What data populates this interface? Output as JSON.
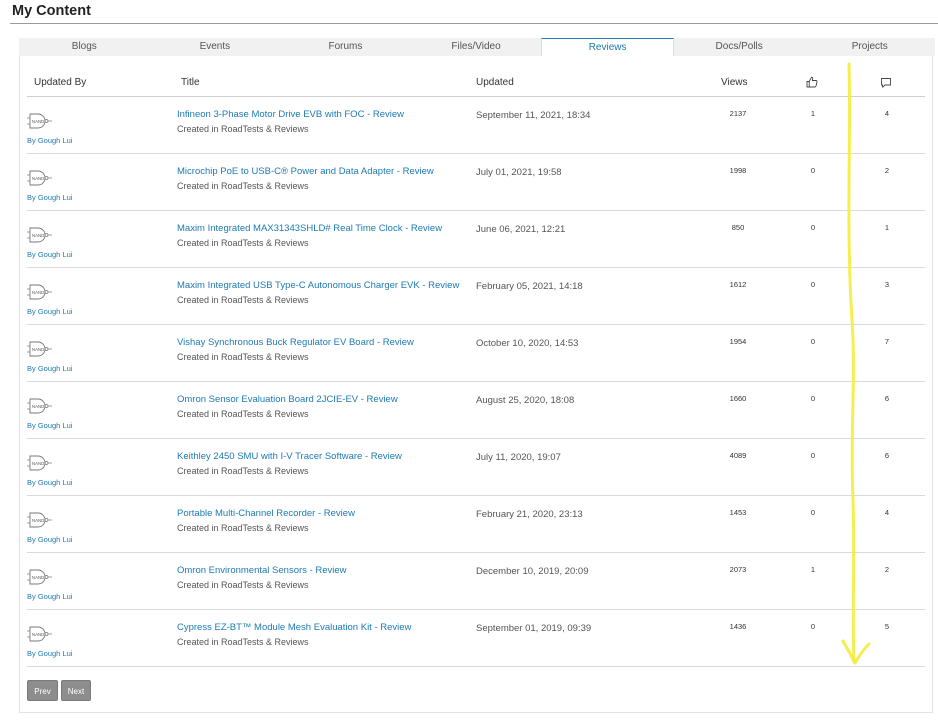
{
  "page_title": "My Content",
  "tabs": [
    {
      "label": "Blogs",
      "active": false
    },
    {
      "label": "Events",
      "active": false
    },
    {
      "label": "Forums",
      "active": false
    },
    {
      "label": "Files/Video",
      "active": false
    },
    {
      "label": "Reviews",
      "active": true
    },
    {
      "label": "Docs/Polls",
      "active": false
    },
    {
      "label": "Projects",
      "active": false
    }
  ],
  "columns": {
    "updated_by": "Updated By",
    "title": "Title",
    "updated": "Updated",
    "views": "Views",
    "likes_icon": "thumbs-up-icon",
    "comments_icon": "comment-icon"
  },
  "rows": [
    {
      "author": "By Gough Lui",
      "title": "Infineon 3-Phase Motor Drive EVB with FOC - Review",
      "created": "Created in RoadTests & Reviews",
      "updated": "September 11, 2021, 18:34",
      "views": "2137",
      "likes": "1",
      "comments": "4"
    },
    {
      "author": "By Gough Lui",
      "title": "Microchip PoE to USB-C® Power and Data Adapter - Review",
      "created": "Created in RoadTests & Reviews",
      "updated": "July 01, 2021, 19:58",
      "views": "1998",
      "likes": "0",
      "comments": "2"
    },
    {
      "author": "By Gough Lui",
      "title": "Maxim Integrated MAX31343SHLD# Real Time Clock - Review",
      "created": "Created in RoadTests & Reviews",
      "updated": "June 06, 2021, 12:21",
      "views": "850",
      "likes": "0",
      "comments": "1"
    },
    {
      "author": "By Gough Lui",
      "title": "Maxim Integrated USB Type-C Autonomous Charger EVK - Review",
      "created": "Created in RoadTests & Reviews",
      "updated": "February 05, 2021, 14:18",
      "views": "1612",
      "likes": "0",
      "comments": "3"
    },
    {
      "author": "By Gough Lui",
      "title": "Vishay Synchronous Buck Regulator EV Board - Review",
      "created": "Created in RoadTests & Reviews",
      "updated": "October 10, 2020, 14:53",
      "views": "1954",
      "likes": "0",
      "comments": "7"
    },
    {
      "author": "By Gough Lui",
      "title": "Omron Sensor Evaluation Board 2JCIE-EV - Review",
      "created": "Created in RoadTests & Reviews",
      "updated": "August 25, 2020, 18:08",
      "views": "1660",
      "likes": "0",
      "comments": "6"
    },
    {
      "author": "By Gough Lui",
      "title": "Keithley 2450 SMU with I-V Tracer Software - Review",
      "created": "Created in RoadTests & Reviews",
      "updated": "July 11, 2020, 19:07",
      "views": "4089",
      "likes": "0",
      "comments": "6"
    },
    {
      "author": "By Gough Lui",
      "title": "Portable Multi-Channel Recorder - Review",
      "created": "Created in RoadTests & Reviews",
      "updated": "February 21, 2020, 23:13",
      "views": "1453",
      "likes": "0",
      "comments": "4"
    },
    {
      "author": "By Gough Lui",
      "title": "Omron Environmental Sensors - Review",
      "created": "Created in RoadTests & Reviews",
      "updated": "December 10, 2019, 20:09",
      "views": "2073",
      "likes": "1",
      "comments": "2"
    },
    {
      "author": "By Gough Lui",
      "title": "Cypress EZ-BT™ Module Mesh Evaluation Kit - Review",
      "created": "Created in RoadTests & Reviews",
      "updated": "September 01, 2019, 09:39",
      "views": "1436",
      "likes": "0",
      "comments": "5"
    }
  ],
  "avatar_logo_text": "NAND",
  "pagination": {
    "prev_label": "Prev",
    "next_label": "Next"
  },
  "annotation": {
    "color": "#f2e93a",
    "icon": "freehand-down-arrow-annotation"
  },
  "colors": {
    "link": "#1d7ab5",
    "button": "#8d8d8d",
    "active_tab_border": "#1d7ab5"
  }
}
